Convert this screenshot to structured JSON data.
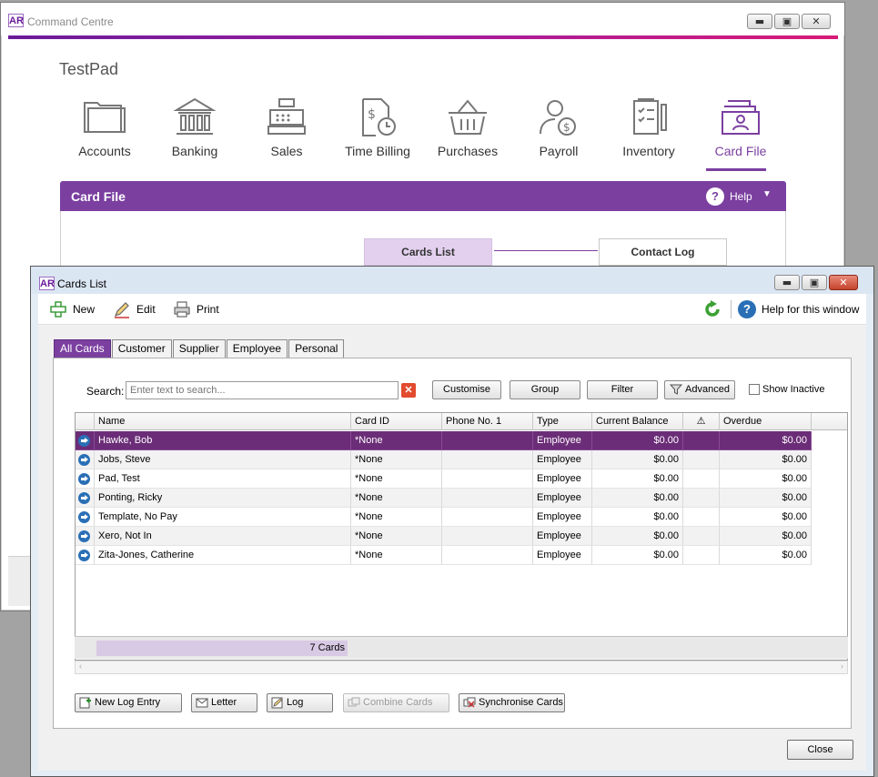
{
  "command_centre": {
    "window_title": "Command Centre",
    "logo": "AR",
    "company_name": "TestPad",
    "modules": [
      {
        "label": "Accounts",
        "icon": "folder-icon"
      },
      {
        "label": "Banking",
        "icon": "bank-icon"
      },
      {
        "label": "Sales",
        "icon": "cash-register-icon"
      },
      {
        "label": "Time Billing",
        "icon": "time-billing-icon"
      },
      {
        "label": "Purchases",
        "icon": "basket-icon"
      },
      {
        "label": "Payroll",
        "icon": "payroll-icon"
      },
      {
        "label": "Inventory",
        "icon": "inventory-icon"
      },
      {
        "label": "Card File",
        "icon": "card-file-icon",
        "active": true
      }
    ],
    "section_title": "Card File",
    "help_label": "Help",
    "flow": {
      "cards_list": "Cards List",
      "contact_log": "Contact Log"
    }
  },
  "cards_window": {
    "title": "Cards List",
    "logo": "AR",
    "toolbar": {
      "new_label": "New",
      "edit_label": "Edit",
      "print_label": "Print",
      "help_label": "Help for this window"
    },
    "tabs": [
      "All Cards",
      "Customer",
      "Supplier",
      "Employee",
      "Personal"
    ],
    "active_tab": "All Cards",
    "search": {
      "label": "Search:",
      "placeholder": "Enter text to search..."
    },
    "buttons": {
      "customise": "Customise",
      "group": "Group",
      "filter": "Filter",
      "advanced": "Advanced",
      "show_inactive": "Show Inactive"
    },
    "columns": [
      "Name",
      "Card ID",
      "Phone No. 1",
      "Type",
      "Current Balance",
      "⚠",
      "Overdue"
    ],
    "rows": [
      {
        "name": "Hawke, Bob",
        "card_id": "*None",
        "phone": "",
        "type": "Employee",
        "balance": "$0.00",
        "flag": "",
        "overdue": "$0.00",
        "selected": true
      },
      {
        "name": "Jobs, Steve",
        "card_id": "*None",
        "phone": "",
        "type": "Employee",
        "balance": "$0.00",
        "flag": "",
        "overdue": "$0.00"
      },
      {
        "name": "Pad, Test",
        "card_id": "*None",
        "phone": "",
        "type": "Employee",
        "balance": "$0.00",
        "flag": "",
        "overdue": "$0.00"
      },
      {
        "name": "Ponting, Ricky",
        "card_id": "*None",
        "phone": "",
        "type": "Employee",
        "balance": "$0.00",
        "flag": "",
        "overdue": "$0.00"
      },
      {
        "name": "Template, No Pay",
        "card_id": "*None",
        "phone": "",
        "type": "Employee",
        "balance": "$0.00",
        "flag": "",
        "overdue": "$0.00"
      },
      {
        "name": "Xero, Not In",
        "card_id": "*None",
        "phone": "",
        "type": "Employee",
        "balance": "$0.00",
        "flag": "",
        "overdue": "$0.00"
      },
      {
        "name": "Zita-Jones, Catherine",
        "card_id": "*None",
        "phone": "",
        "type": "Employee",
        "balance": "$0.00",
        "flag": "",
        "overdue": "$0.00"
      }
    ],
    "card_count": "7 Cards",
    "bottom_buttons": {
      "new_log_entry": "New Log Entry",
      "letter": "Letter",
      "log": "Log",
      "combine_cards": "Combine Cards",
      "synchronise_cards": "Synchronise Cards"
    },
    "close_label": "Close"
  },
  "colors": {
    "accent": "#7b3fa0",
    "selected_row": "#6b2d77",
    "refresh": "#3aa132",
    "help_blue": "#2a6fb6"
  }
}
